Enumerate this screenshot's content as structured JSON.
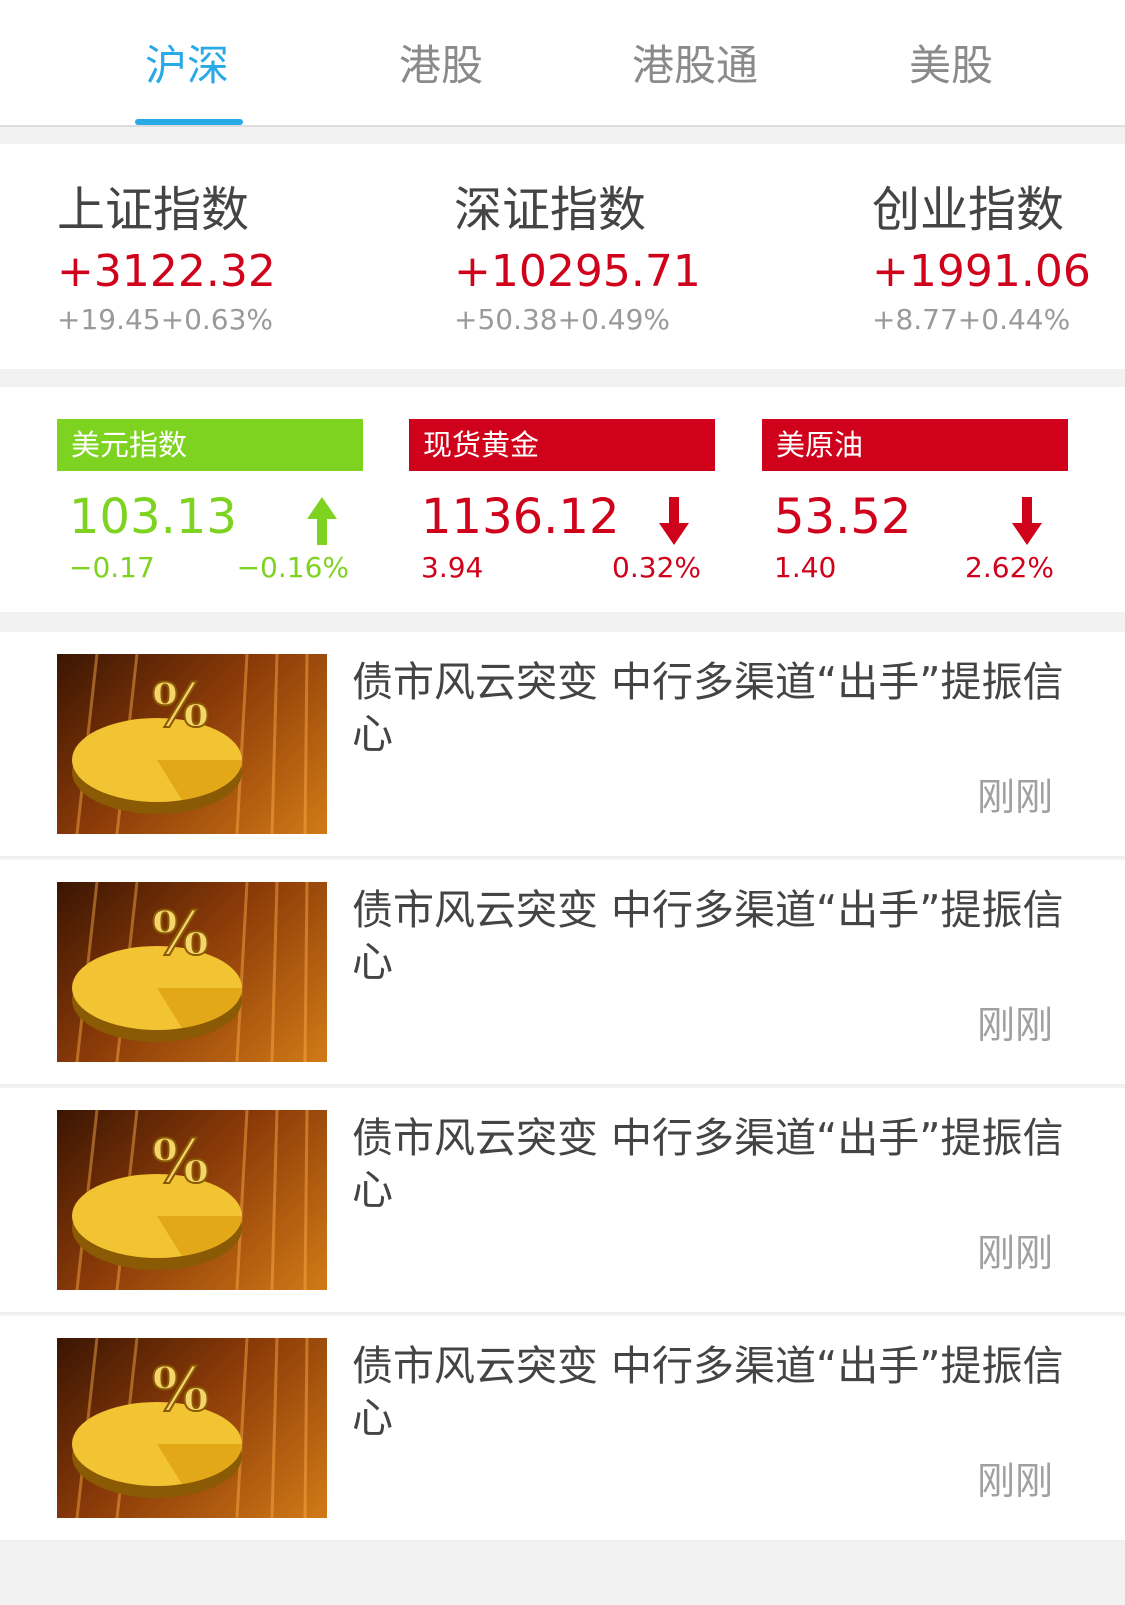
{
  "tabs": [
    {
      "label": "沪深",
      "active": true
    },
    {
      "label": "港股",
      "active": false
    },
    {
      "label": "港股通",
      "active": false
    },
    {
      "label": "美股",
      "active": false
    }
  ],
  "indices": [
    {
      "name": "上证指数",
      "value": "+3122.32",
      "change": "+19.45+0.63%"
    },
    {
      "name": "深证指数",
      "value": "+10295.71",
      "change": "+50.38+0.49%"
    },
    {
      "name": "创业指数",
      "value": "+1991.06",
      "change": "+8.77+0.44%"
    }
  ],
  "commodities": [
    {
      "name": "美元指数",
      "value": "103.13",
      "abs": "−0.17",
      "pct": "−0.16%",
      "direction": "up",
      "color": "#7ed321"
    },
    {
      "name": "现货黄金",
      "value": "1136.12",
      "abs": "3.94",
      "pct": "0.32%",
      "direction": "down",
      "color": "#d0021b"
    },
    {
      "name": "美原油",
      "value": "53.52",
      "abs": "1.40",
      "pct": "2.62%",
      "direction": "down",
      "color": "#d0021b"
    }
  ],
  "news": [
    {
      "title": "债市风云突变 中行多渠道“出手”提振信心",
      "time": "刚刚"
    },
    {
      "title": "债市风云突变 中行多渠道“出手”提振信心",
      "time": "刚刚"
    },
    {
      "title": "债市风云突变 中行多渠道“出手”提振信心",
      "time": "刚刚"
    },
    {
      "title": "债市风云突变 中行多渠道“出手”提振信心",
      "time": "刚刚"
    }
  ],
  "colors": {
    "accent": "#29a9e6",
    "up_red": "#d0021b",
    "green": "#7ed321",
    "muted": "#9a9a9a"
  }
}
